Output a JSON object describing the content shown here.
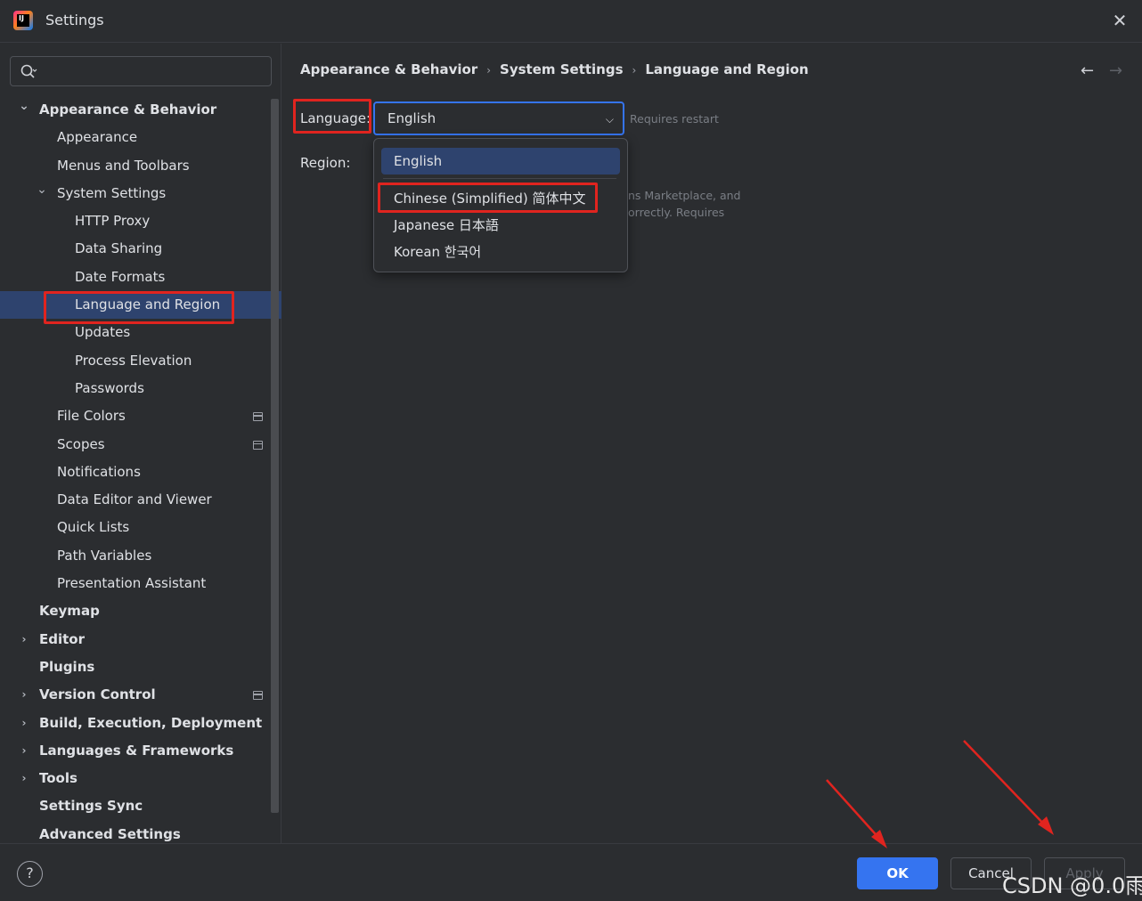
{
  "window": {
    "title": "Settings"
  },
  "search": {
    "placeholder": ""
  },
  "tree": [
    {
      "label": "Appearance & Behavior",
      "level": 0,
      "bold": true,
      "chevron": "down"
    },
    {
      "label": "Appearance",
      "level": 1
    },
    {
      "label": "Menus and Toolbars",
      "level": 1
    },
    {
      "label": "System Settings",
      "level": 1,
      "chevron": "down"
    },
    {
      "label": "HTTP Proxy",
      "level": 2
    },
    {
      "label": "Data Sharing",
      "level": 2
    },
    {
      "label": "Date Formats",
      "level": 2
    },
    {
      "label": "Language and Region",
      "level": 2,
      "selected": true
    },
    {
      "label": "Updates",
      "level": 2
    },
    {
      "label": "Process Elevation",
      "level": 2
    },
    {
      "label": "Passwords",
      "level": 2
    },
    {
      "label": "File Colors",
      "level": 1,
      "project_icon": true
    },
    {
      "label": "Scopes",
      "level": 1,
      "project_icon": true
    },
    {
      "label": "Notifications",
      "level": 1
    },
    {
      "label": "Data Editor and Viewer",
      "level": 1
    },
    {
      "label": "Quick Lists",
      "level": 1
    },
    {
      "label": "Path Variables",
      "level": 1
    },
    {
      "label": "Presentation Assistant",
      "level": 1
    },
    {
      "label": "Keymap",
      "level": 0,
      "bold": true
    },
    {
      "label": "Editor",
      "level": 0,
      "bold": true,
      "chevron": "right"
    },
    {
      "label": "Plugins",
      "level": 0,
      "bold": true
    },
    {
      "label": "Version Control",
      "level": 0,
      "bold": true,
      "chevron": "right",
      "project_icon": true
    },
    {
      "label": "Build, Execution, Deployment",
      "level": 0,
      "bold": true,
      "chevron": "right"
    },
    {
      "label": "Languages & Frameworks",
      "level": 0,
      "bold": true,
      "chevron": "right"
    },
    {
      "label": "Tools",
      "level": 0,
      "bold": true,
      "chevron": "right"
    },
    {
      "label": "Settings Sync",
      "level": 0,
      "bold": true
    },
    {
      "label": "Advanced Settings",
      "level": 0,
      "bold": true
    }
  ],
  "breadcrumb": [
    "Appearance & Behavior",
    "System Settings",
    "Language and Region"
  ],
  "content": {
    "language_label": "Language:",
    "language_value": "English",
    "requires_restart": "Requires restart",
    "region_label": "Region:",
    "desc_line1": "ns Marketplace, and",
    "desc_line2": "orrectly. Requires"
  },
  "dropdown": {
    "options": [
      "English",
      "Chinese (Simplified) 简体中文",
      "Japanese 日本語",
      "Korean 한국어"
    ],
    "selected_index": 0
  },
  "buttons": {
    "help": "?",
    "ok": "OK",
    "cancel": "Cancel",
    "apply": "Apply"
  },
  "watermark": "CSDN @0.0雨",
  "colors": {
    "accent": "#3574f0",
    "highlight": "#e0241f",
    "selection": "#2e436e"
  }
}
